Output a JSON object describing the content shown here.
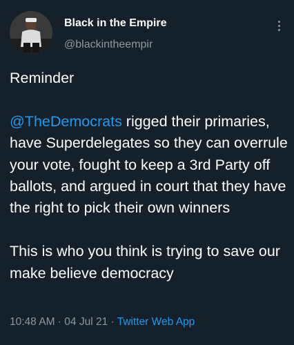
{
  "author": {
    "display_name": "Black in the Empire",
    "handle": "@blackintheempir"
  },
  "more_icon": "more-vertical-icon",
  "tweet": {
    "line1": "Reminder",
    "mention": "@TheDemocrats",
    "line2_rest": " rigged their primaries, have Superdelegates so they can overrule your vote, fought to keep a 3rd Party off ballots, and argued in court that they have the right to pick their own winners",
    "line3": "This is who you think is trying to save our make believe democracy"
  },
  "meta": {
    "time": "10:48 AM",
    "separator1": " · ",
    "date": "04 Jul 21",
    "separator2": " · ",
    "app": "Twitter Web App"
  },
  "colors": {
    "background": "#15202b",
    "link": "#1d9bf0",
    "secondary": "#8b98a5"
  }
}
